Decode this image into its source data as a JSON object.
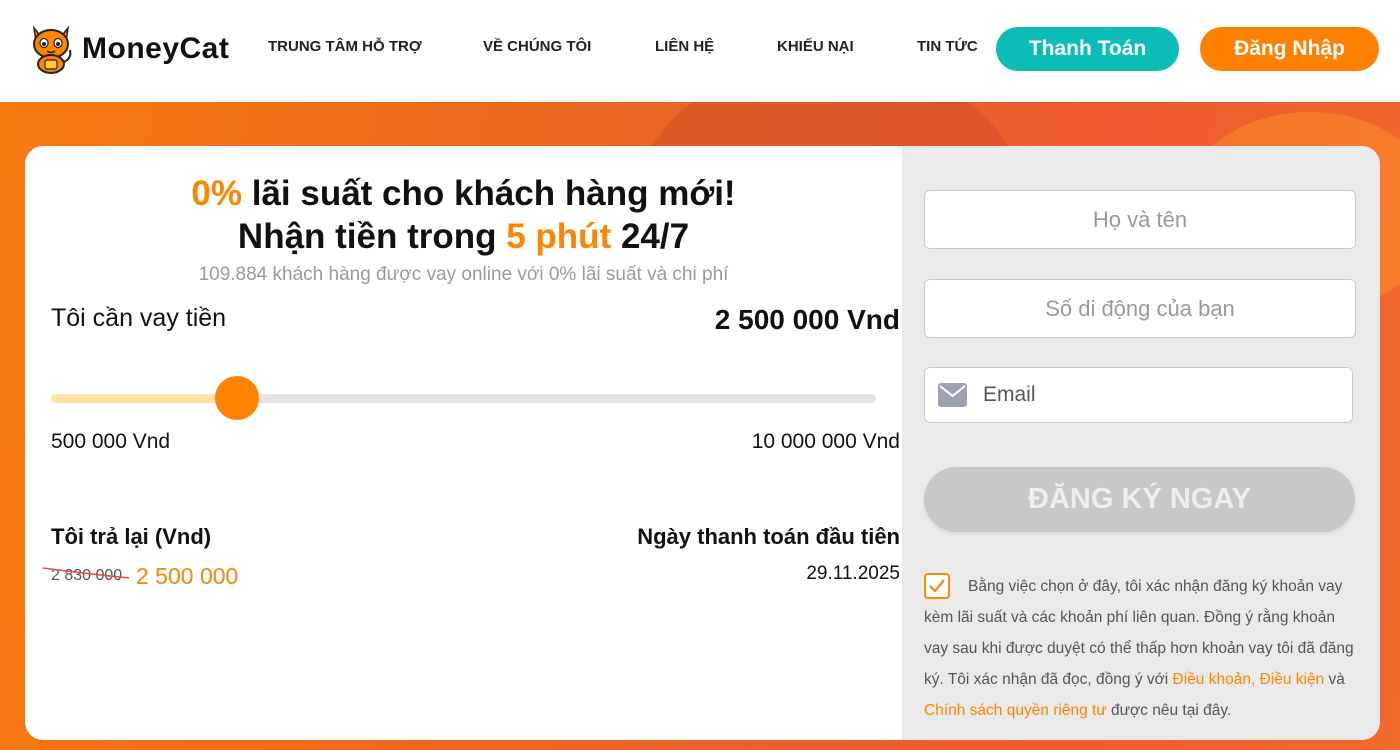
{
  "brand": {
    "name": "MoneyCat"
  },
  "nav": {
    "items": [
      {
        "label": "TRUNG TÂM HỖ TRỢ"
      },
      {
        "label": "VỀ CHÚNG TÔI"
      },
      {
        "label": "LIÊN HỆ"
      },
      {
        "label": "KHIẾU NẠI"
      },
      {
        "label": "TIN TỨC"
      }
    ],
    "pay_button": "Thanh Toán",
    "login_button": "Đăng Nhập"
  },
  "hero": {
    "headline_1_highlight": "0%",
    "headline_1_rest": " lãi suất cho khách hàng mới!",
    "headline_2_start": "Nhận tiền trong ",
    "headline_2_highlight": "5 phút",
    "headline_2_end": " 24/7",
    "subline": "109.884 khách hàng được vay online với 0% lãi suất và chi phí"
  },
  "calculator": {
    "loan_label": "Tôi cần vay tiền",
    "loan_amount": "2 500 000 Vnd",
    "slider_value_fraction": 0.2258,
    "min_label": "500 000 Vnd",
    "max_label": "10 000 000 Vnd",
    "repay_label": "Tôi trả lại (Vnd)",
    "repay_old": "2 830 000",
    "repay_new": "2 500 000",
    "first_payment_label": "Ngày thanh toán đầu tiên",
    "first_payment_date": "29.11.2025"
  },
  "form": {
    "name_placeholder": "Họ và tên",
    "phone_placeholder": "Số di động của bạn",
    "email_placeholder": "Email",
    "register_button": "ĐĂNG KÝ NGAY",
    "consent_checked": true,
    "consent_text_1": "Bằng việc chọn ở đây, tôi xác nhận đăng ký khoản vay kèm lãi suất và các khoản phí liên quan. Đồng ý rằng khoản vay sau khi được duyệt có thể thấp hơn khoản vay tôi đã đăng ký. Tôi xác nhận đã đọc, đồng ý với ",
    "consent_link_terms": "Điều khoản, Điều kiện",
    "consent_text_2": " và ",
    "consent_link_privacy": "Chính sách quyền riêng tư",
    "consent_text_3": " được nêu tại đây."
  },
  "colors": {
    "accent_orange": "#ff8400",
    "teal": "#0bbdb6",
    "slider_fill": "#fde2a6",
    "disabled_button": "#c8c8c8"
  },
  "icons": [
    "cat-logo-icon",
    "mail-icon",
    "checkmark-icon"
  ]
}
